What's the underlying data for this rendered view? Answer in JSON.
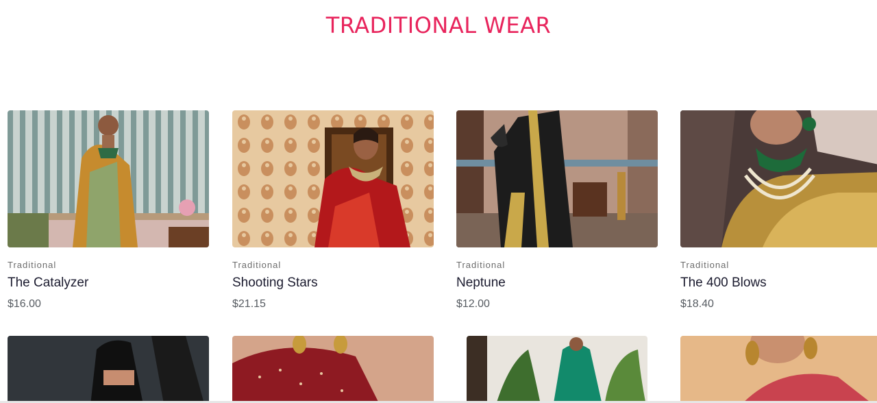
{
  "section": {
    "title": "TRADITIONAL WEAR",
    "title_color": "#e8245c"
  },
  "products": [
    {
      "category": "Traditional",
      "name": "The Catalyzer",
      "price": "$16.00"
    },
    {
      "category": "Traditional",
      "name": "Shooting Stars",
      "price": "$21.15"
    },
    {
      "category": "Traditional",
      "name": "Neptune",
      "price": "$12.00"
    },
    {
      "category": "Traditional",
      "name": "The 400 Blows",
      "price": "$18.40"
    }
  ]
}
